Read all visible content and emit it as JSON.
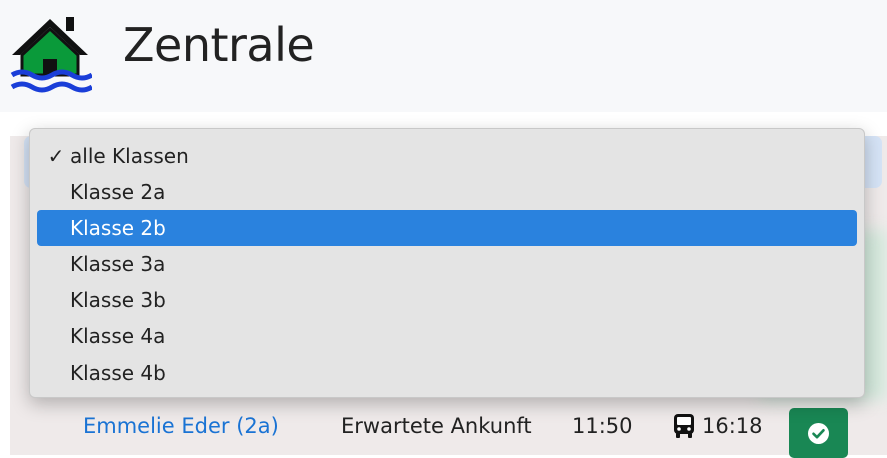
{
  "header": {
    "title": "Zentrale",
    "logo_icon": "house-flood-icon"
  },
  "class_filter": {
    "selected": "alle Klassen",
    "highlighted": "Klasse 2b",
    "options": [
      {
        "label": "alle Klassen",
        "checked": true
      },
      {
        "label": "Klasse 2a",
        "checked": false
      },
      {
        "label": "Klasse 2b",
        "checked": false
      },
      {
        "label": "Klasse 3a",
        "checked": false
      },
      {
        "label": "Klasse 3b",
        "checked": false
      },
      {
        "label": "Klasse 4a",
        "checked": false
      },
      {
        "label": "Klasse 4b",
        "checked": false
      }
    ],
    "check_mark": "✓"
  },
  "students": [
    {
      "name": "Emmelie Eder (2a)",
      "status_label": "Erwartete Ankunft",
      "expected_time": "11:50",
      "bus_time": "16:18",
      "bus_icon": "bus-icon",
      "action_icon": "check-circle-icon"
    }
  ],
  "colors": {
    "accent": "#2a82de",
    "link": "#1a73d4",
    "success": "#198754",
    "logo_house": "#0a9a3a",
    "logo_water": "#1a3ed8"
  }
}
